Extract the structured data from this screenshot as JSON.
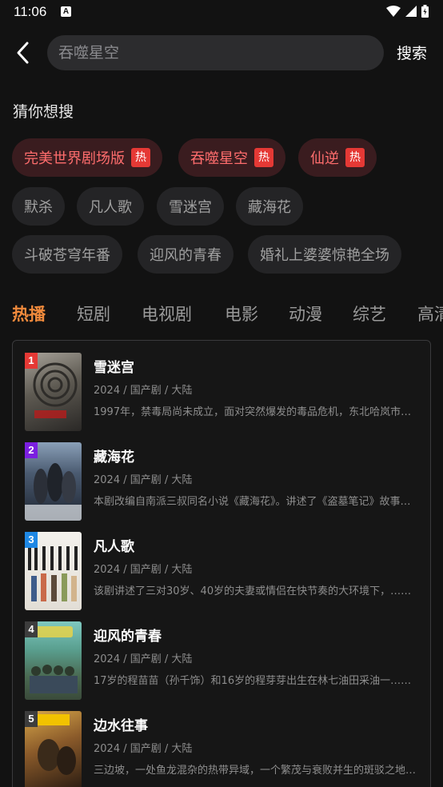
{
  "status_bar": {
    "time": "11:06",
    "notif": "A"
  },
  "search": {
    "placeholder": "吞噬星空",
    "button_label": "搜索"
  },
  "guess": {
    "title": "猜你想搜",
    "hot_label": "热",
    "chips": [
      {
        "label": "完美世界剧场版",
        "hot": true
      },
      {
        "label": "吞噬星空",
        "hot": true
      },
      {
        "label": "仙逆",
        "hot": true
      },
      {
        "label": "默杀",
        "hot": false
      },
      {
        "label": "凡人歌",
        "hot": false
      },
      {
        "label": "雪迷宫",
        "hot": false
      },
      {
        "label": "藏海花",
        "hot": false
      },
      {
        "label": "斗破苍穹年番",
        "hot": false
      },
      {
        "label": "迎风的青春",
        "hot": false
      },
      {
        "label": "婚礼上婆婆惊艳全场",
        "hot": false
      }
    ]
  },
  "tabs": [
    "热播",
    "短剧",
    "电视剧",
    "电影",
    "动漫",
    "综艺",
    "高清"
  ],
  "active_tab": "热播",
  "ranking": [
    {
      "rank": "1",
      "title": "雪迷宫",
      "meta": "2024 / 国产剧 / 大陆",
      "desc": "1997年，禁毒局尚未成立，面对突然爆发的毒品危机，东北哈岚市……",
      "badge_color": "#e53935"
    },
    {
      "rank": "2",
      "title": "藏海花",
      "meta": "2024 / 国产剧 / 大陆",
      "desc": "本剧改编自南派三叔同名小说《藏海花》。讲述了《盗墓笔记》故事……",
      "badge_color": "#7b1fe0"
    },
    {
      "rank": "3",
      "title": "凡人歌",
      "meta": "2024 / 国产剧 / 大陆",
      "desc": "该剧讲述了三对30岁、40岁的夫妻或情侣在快节奏的大环境下，……",
      "badge_color": "#1e88e5"
    },
    {
      "rank": "4",
      "title": "迎风的青春",
      "meta": "2024 / 国产剧 / 大陆",
      "desc": "17岁的程苗苗（孙千饰）和16岁的程芽芽出生在林七油田采油一……",
      "badge_color": "#3d3d3d"
    },
    {
      "rank": "5",
      "title": "边水往事",
      "meta": "2024 / 国产剧 / 大陆",
      "desc": "三边坡，一处鱼龙混杂的热带异域，一个繁茂与衰败并生的斑驳之地……",
      "badge_color": "#3d3d3d"
    }
  ]
}
